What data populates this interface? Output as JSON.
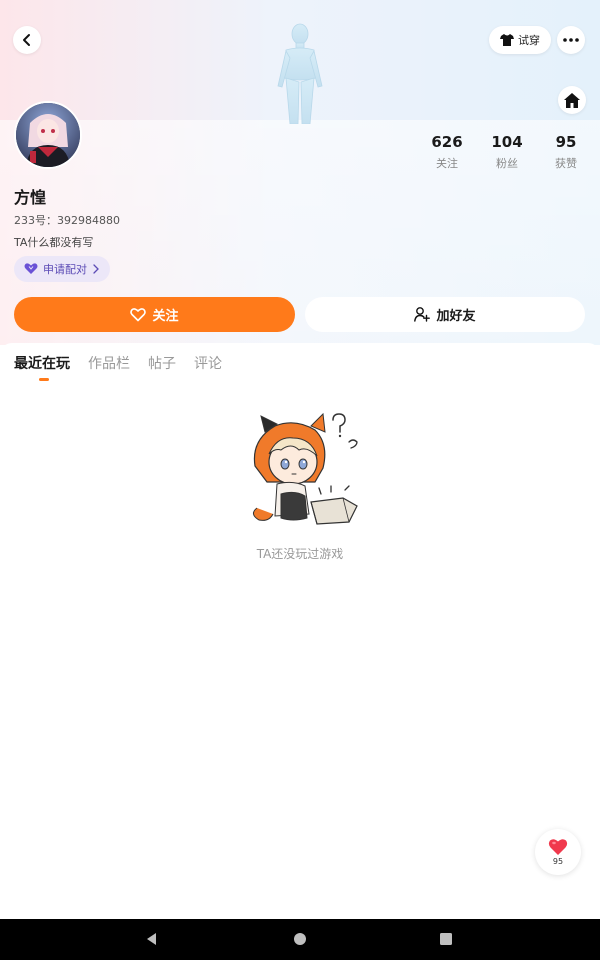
{
  "header": {
    "tryon_label": "试穿"
  },
  "profile": {
    "nickname": "方惶",
    "uid_text": "233号：392984880",
    "bio": "TA什么都没有写",
    "pair_label": "申请配对"
  },
  "stats": [
    {
      "value": "626",
      "label": "关注"
    },
    {
      "value": "104",
      "label": "粉丝"
    },
    {
      "value": "95",
      "label": "获赞"
    }
  ],
  "actions": {
    "follow_label": "关注",
    "add_friend_label": "加好友"
  },
  "tabs": [
    {
      "label": "最近在玩",
      "active": true
    },
    {
      "label": "作品栏",
      "active": false
    },
    {
      "label": "帖子",
      "active": false
    },
    {
      "label": "评论",
      "active": false
    }
  ],
  "empty_state": {
    "message": "TA还没玩过游戏"
  },
  "like_button": {
    "count": "95"
  },
  "colors": {
    "accent": "#ff7a1a",
    "pair_bg": "#ece7f8",
    "pair_text": "#5b4bb5",
    "like_heart": "#f0394d"
  },
  "icons": {
    "back": "back-arrow-icon",
    "tryon": "tshirt-icon",
    "more": "more-dots-icon",
    "home": "home-icon",
    "pair": "heart-pair-icon",
    "follow": "heart-outline-icon",
    "add_friend": "add-user-icon",
    "like": "heart-filled-icon"
  }
}
